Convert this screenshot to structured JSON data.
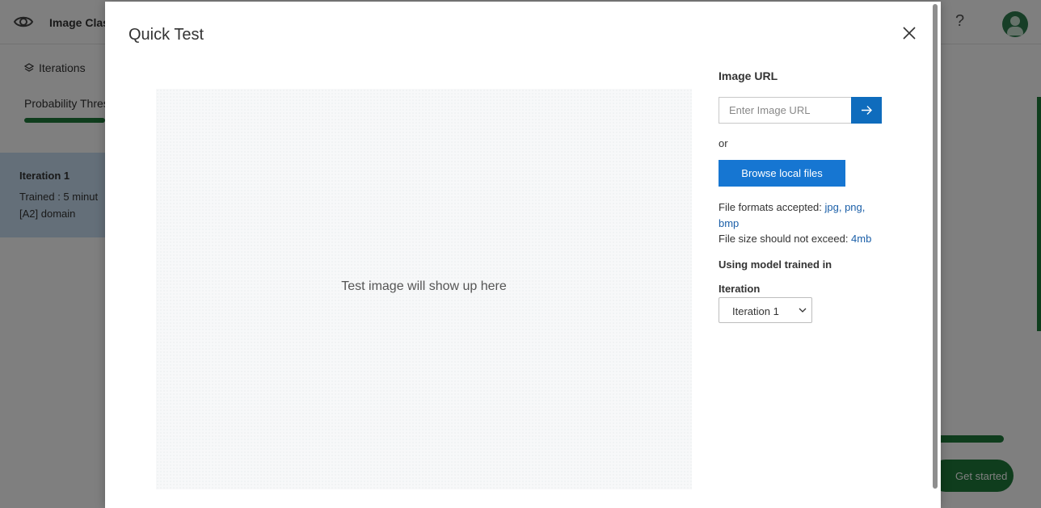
{
  "app": {
    "title": "Image Clas",
    "help": "?",
    "sidebar": {
      "iterations_tab": "Iterations",
      "probability_label": "Probability Thres",
      "iteration": {
        "name": "Iteration 1",
        "trained": "Trained : 5 minut",
        "domain": "[A2] domain"
      }
    },
    "get_started": "Get started"
  },
  "modal": {
    "title": "Quick Test",
    "preview_text": "Test image will show up here",
    "image_url_label": "Image URL",
    "url_placeholder": "Enter Image URL",
    "or_text": "or",
    "browse_button": "Browse local files",
    "formats_prefix": "File formats accepted: ",
    "formats_value": "jpg, png, bmp",
    "size_prefix": "File size should not exceed: ",
    "size_value": "4mb",
    "model_label": "Using model trained in",
    "iteration_label": "Iteration",
    "iteration_selected": "Iteration 1"
  },
  "colors": {
    "primary_button": "#1676d2",
    "url_go_button": "#0f6cbd",
    "link": "#1b5fa8",
    "brand_green": "#1f7a3a",
    "selected_card": "#c9dff2"
  },
  "icons": [
    "eye-icon",
    "layers-icon",
    "help-icon",
    "avatar",
    "close-icon",
    "arrow-right-icon",
    "chevron-down-icon"
  ]
}
